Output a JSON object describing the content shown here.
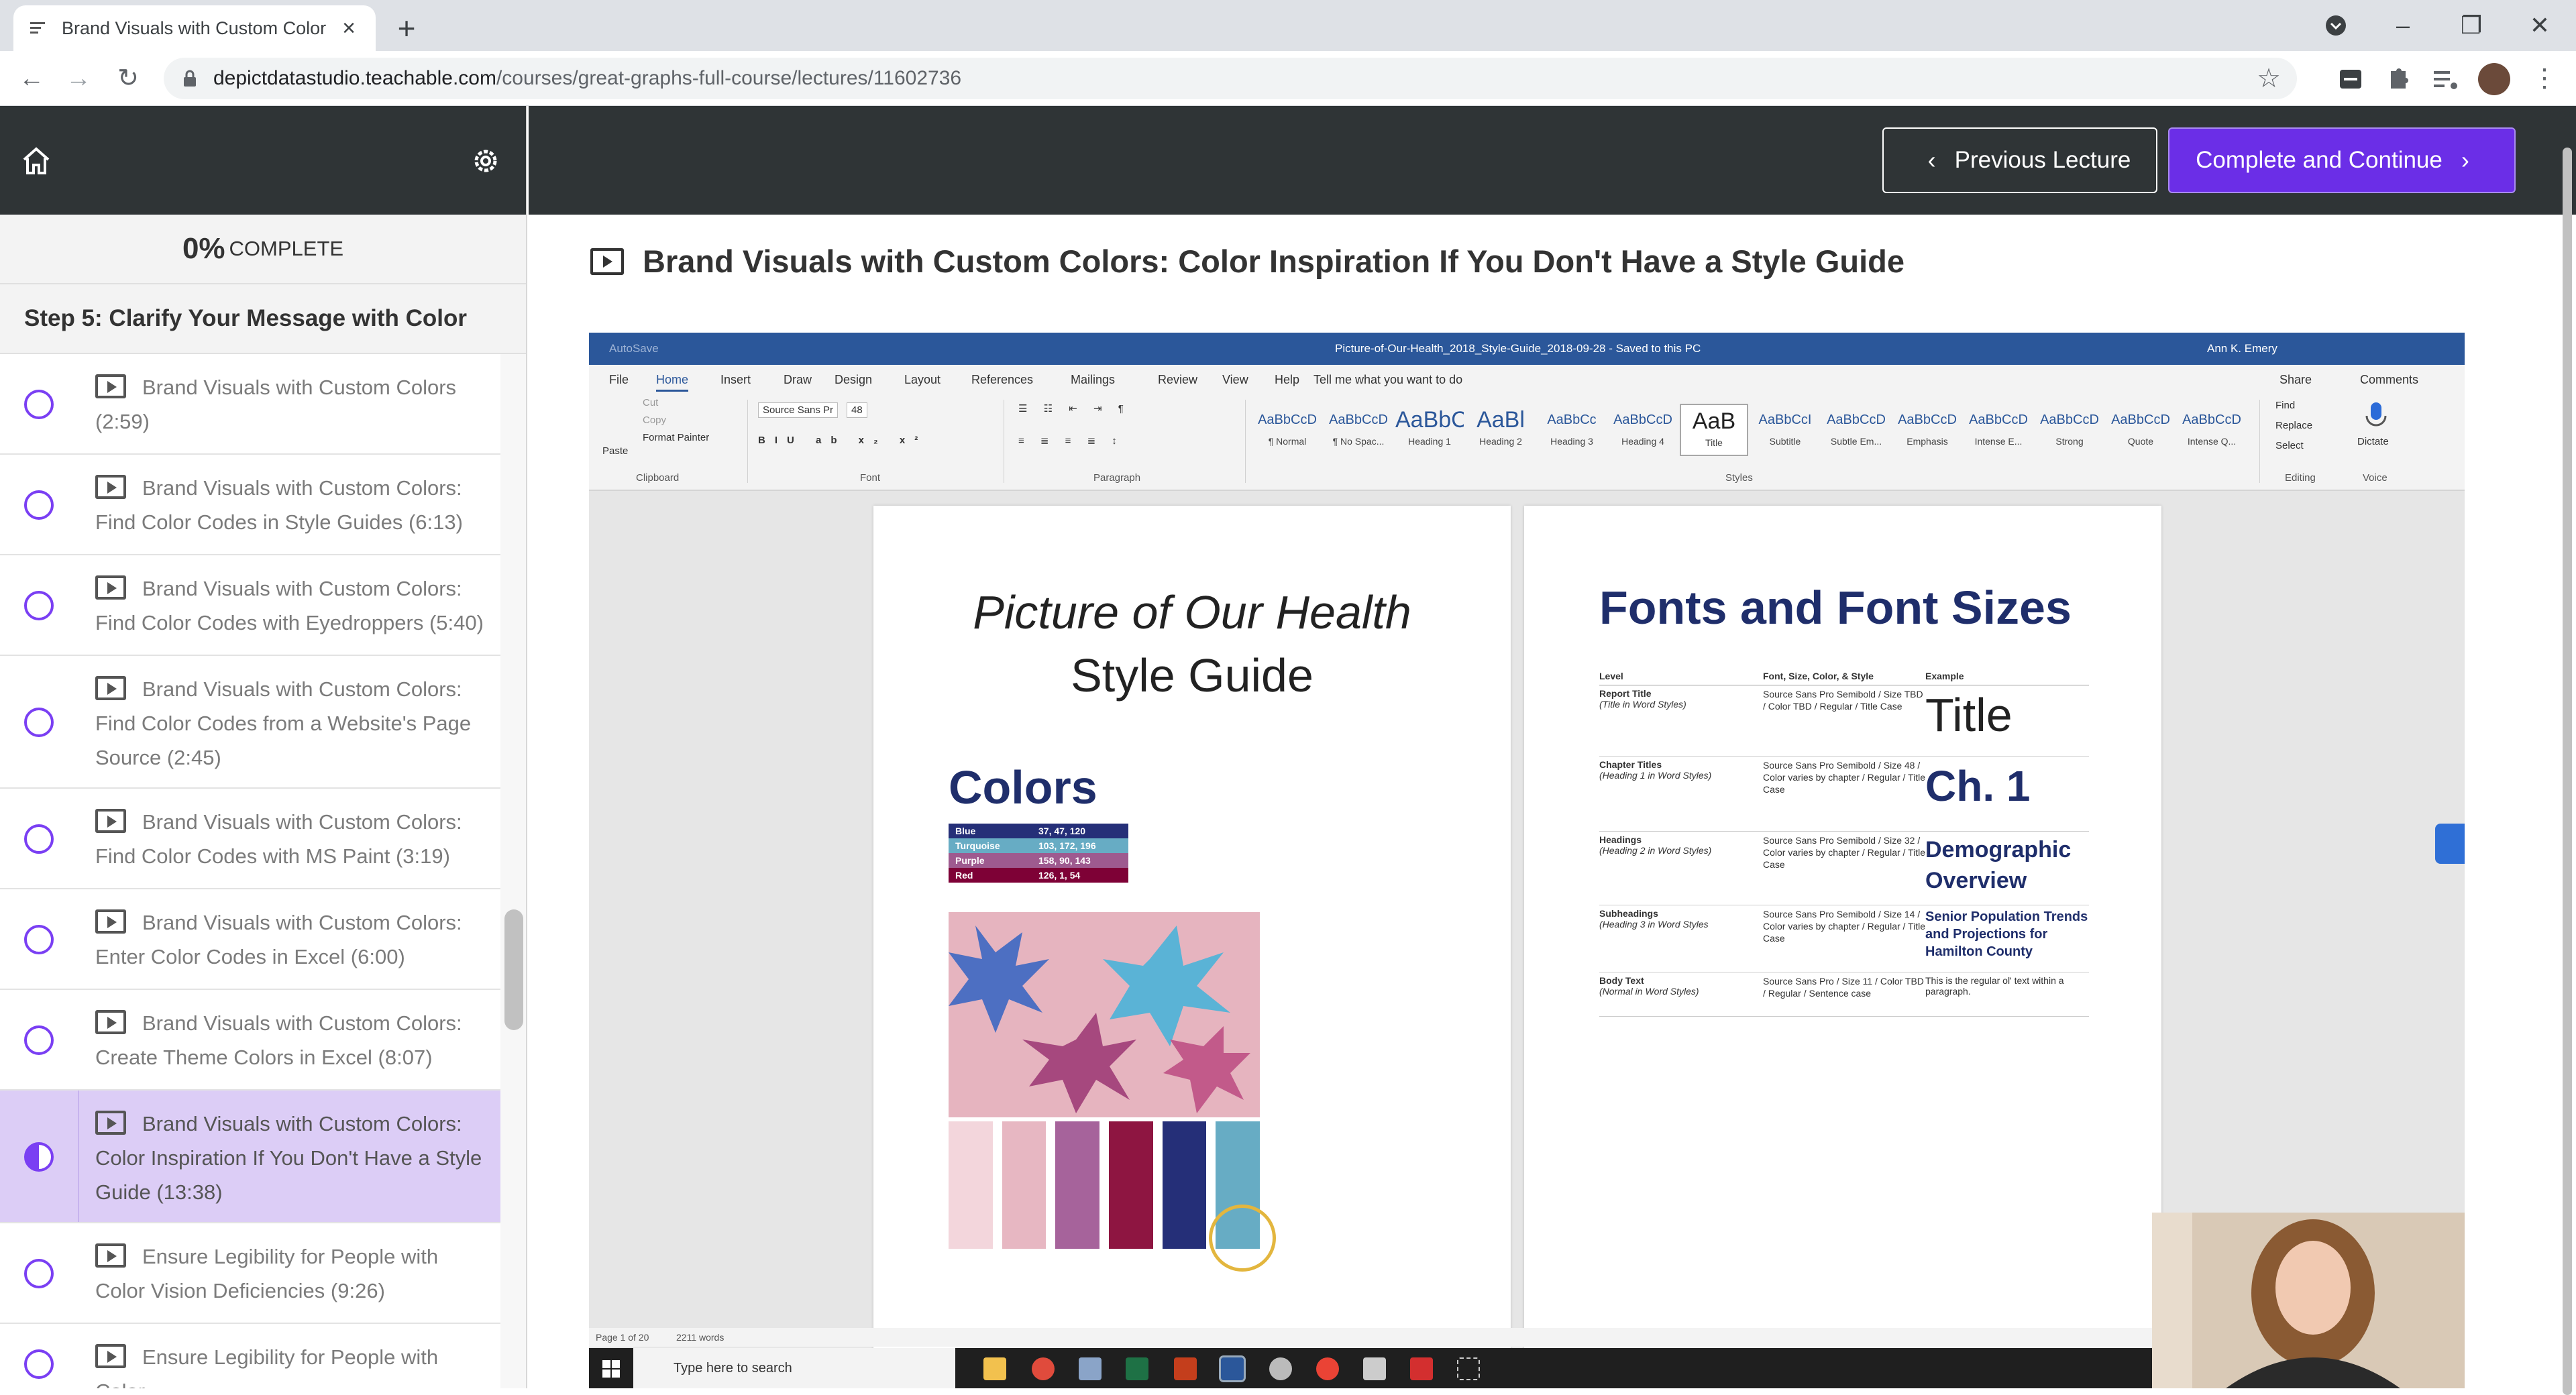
{
  "browser": {
    "tab_title": "Brand Visuals with Custom Color",
    "url_host": "depictdatastudio.teachable.com",
    "url_path": "/courses/great-graphs-full-course/lectures/11602736"
  },
  "sidebar": {
    "progress_pct": "0%",
    "progress_label": "COMPLETE",
    "section_title": "Step 5: Clarify Your Message with Color",
    "items": [
      {
        "label": "Brand Visuals with Custom Colors (2:59)"
      },
      {
        "label": "Brand Visuals with Custom Colors: Find Color Codes in Style Guides (6:13)"
      },
      {
        "label": "Brand Visuals with Custom Colors: Find Color Codes with Eyedroppers (5:40)"
      },
      {
        "label": "Brand Visuals with Custom Colors: Find Color Codes from a Website's Page Source (2:45)"
      },
      {
        "label": "Brand Visuals with Custom Colors: Find Color Codes with MS Paint (3:19)"
      },
      {
        "label": "Brand Visuals with Custom Colors: Enter Color Codes in Excel (6:00)"
      },
      {
        "label": "Brand Visuals with Custom Colors: Create Theme Colors in Excel (8:07)"
      },
      {
        "label": "Brand Visuals with Custom Colors: Color Inspiration If You Don't Have a Style Guide (13:38)",
        "active": true
      },
      {
        "label": "Ensure Legibility for People with Color Vision Deficiencies (9:26)"
      },
      {
        "label": "Ensure Legibility for People with Color"
      }
    ]
  },
  "header": {
    "prev_label": "Previous Lecture",
    "next_label": "Complete and Continue"
  },
  "lecture": {
    "title": "Brand Visuals with Custom Colors: Color Inspiration If You Don't Have a Style Guide"
  },
  "word": {
    "autosave": "AutoSave",
    "doc_title": "Picture-of-Our-Health_2018_Style-Guide_2018-09-28  -  Saved to this PC",
    "user": "Ann K. Emery",
    "menu": [
      "File",
      "Home",
      "Insert",
      "Draw",
      "Design",
      "Layout",
      "References",
      "Mailings",
      "Review",
      "View",
      "Help"
    ],
    "tell_me": "Tell me what you want to do",
    "share": "Share",
    "comments": "Comments",
    "clipboard": {
      "paste": "Paste",
      "cut": "Cut",
      "copy": "Copy",
      "format_painter": "Format Painter",
      "group": "Clipboard"
    },
    "font": {
      "name": "Source Sans Pr",
      "size": "48",
      "group": "Font"
    },
    "paragraph_group": "Paragraph",
    "styles_group": "Styles",
    "editing": {
      "find": "Find",
      "replace": "Replace",
      "select": "Select",
      "group": "Editing"
    },
    "voice": {
      "dictate": "Dictate",
      "group": "Voice"
    },
    "styles": [
      {
        "sample": "AaBbCcD",
        "name": "¶ Normal"
      },
      {
        "sample": "AaBbCcD",
        "name": "¶ No Spac..."
      },
      {
        "sample": "AaBbC",
        "name": "Heading 1"
      },
      {
        "sample": "AaBl",
        "name": "Heading 2"
      },
      {
        "sample": "AaBbCc",
        "name": "Heading 3"
      },
      {
        "sample": "AaBbCcD",
        "name": "Heading 4"
      },
      {
        "sample": "AaB",
        "name": "Title"
      },
      {
        "sample": "AaBbCcI",
        "name": "Subtitle"
      },
      {
        "sample": "AaBbCcD",
        "name": "Subtle Em..."
      },
      {
        "sample": "AaBbCcD",
        "name": "Emphasis"
      },
      {
        "sample": "AaBbCcD",
        "name": "Intense E..."
      },
      {
        "sample": "AaBbCcD",
        "name": "Strong"
      },
      {
        "sample": "AaBbCcD",
        "name": "Quote"
      },
      {
        "sample": "AaBbCcD",
        "name": "Intense Q..."
      }
    ],
    "page1": {
      "title_italic": "Picture of Our Health",
      "title_line2": "Style Guide",
      "colors_heading": "Colors",
      "swatches": [
        {
          "name": "Blue",
          "rgb": "37, 47, 120",
          "color": "#252f78"
        },
        {
          "name": "Turquoise",
          "rgb": "103, 172, 196",
          "color": "#67acc4"
        },
        {
          "name": "Purple",
          "rgb": "158, 90, 143",
          "color": "#9e5a8f"
        },
        {
          "name": "Red",
          "rgb": "126, 1, 54",
          "color": "#7e0136"
        }
      ],
      "palette": [
        "#f3d6dc",
        "#e7b7c2",
        "#a6639b",
        "#8e1541",
        "#252f78",
        "#67acc4"
      ]
    },
    "page2": {
      "title": "Fonts and Font Sizes",
      "headers": [
        "Level",
        "Font, Size, Color, & Style",
        "Example"
      ],
      "rows": [
        {
          "level": "Report Title",
          "sub": "(Title in Word Styles)",
          "spec": "Source Sans Pro Semibold / Size TBD / Color TBD / Regular / Title Case",
          "example": "Title"
        },
        {
          "level": "Chapter Titles",
          "sub": "(Heading 1 in Word Styles)",
          "spec": "Source Sans Pro Semibold / Size 48 / Color varies by chapter / Regular / Title Case",
          "example": "Ch. 1"
        },
        {
          "level": "Headings",
          "sub": "(Heading 2 in Word Styles)",
          "spec": "Source Sans Pro Semibold / Size 32 / Color varies by chapter / Regular / Title Case",
          "example": "Demographic Overview"
        },
        {
          "level": "Subheadings",
          "sub": "(Heading 3 in Word Styles",
          "spec": "Source Sans Pro Semibold / Size 14 / Color varies by chapter / Regular / Title Case",
          "example": "Senior Population Trends and Projections for Hamilton County"
        },
        {
          "level": "Body Text",
          "sub": "(Normal in Word Styles)",
          "spec": "Source Sans Pro / Size 11 / Color TBD / Regular / Sentence case",
          "example": "This is the regular ol' text within a paragraph."
        }
      ]
    },
    "status": {
      "page": "Page 1 of 20",
      "words": "2211 words"
    },
    "taskbar_search": "Type here to search"
  },
  "colors": {
    "accent": "#6b2ee7",
    "header_bg": "#2f3436",
    "active_item": "#dccdf6"
  }
}
